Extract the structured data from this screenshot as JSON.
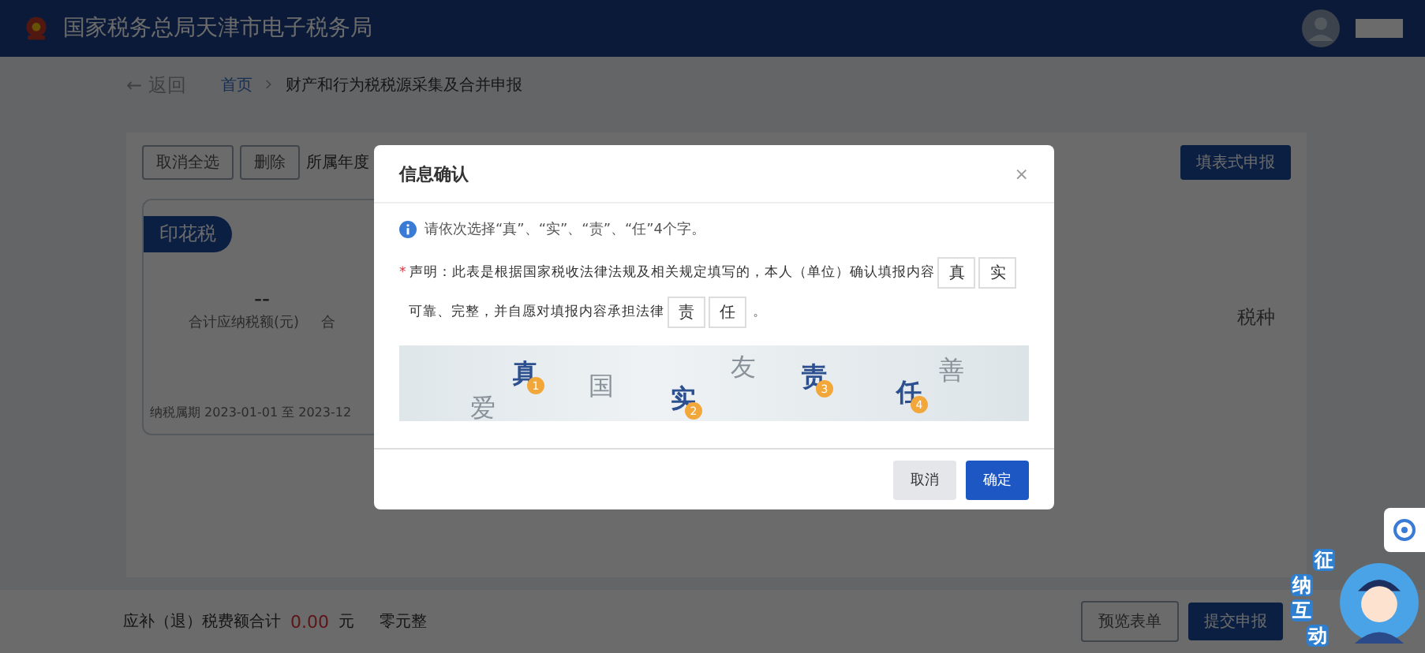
{
  "header": {
    "title": "国家税务总局天津市电子税务局"
  },
  "nav": {
    "back": "← 返回",
    "breadcrumb": [
      "首页",
      "财产和行为税税源采集及合并申报"
    ]
  },
  "toolbar": {
    "buttons": [
      "取消全选",
      "删除"
    ],
    "year_label": "所属年度",
    "form_button": "填表式申报"
  },
  "card": {
    "tag": "印花税",
    "value": "--",
    "labels": [
      "合计应纳税额(元)",
      "合"
    ],
    "period": "纳税属期 2023-01-01 至 2023-12",
    "side_text": "税种"
  },
  "footer": {
    "label": "应补（退）税费额合计",
    "amount": "0.00",
    "unit": "元",
    "words": "零元整",
    "buttons": [
      {
        "label": "预览表单",
        "primary": false
      },
      {
        "label": "提交申报",
        "primary": true
      }
    ]
  },
  "dialog": {
    "title": "信息确认",
    "close": "×",
    "hint": "请依次选择“真”、“实”、“责”、“任”4个字。",
    "statement": {
      "required": "*",
      "text_1": "声明：此表是根据国家税收法律法规及相关规定填写的，本人（单位）确认填报内容",
      "slots_1": [
        "真",
        "实"
      ],
      "text_2": "可靠、完整，并自愿对填报内容承担法律",
      "slots_2": [
        "责",
        "任"
      ],
      "end": "。"
    },
    "captcha": [
      {
        "char": "爱",
        "selected": false
      },
      {
        "char": "真",
        "selected": true,
        "order": "1"
      },
      {
        "char": "国",
        "selected": false
      },
      {
        "char": "实",
        "selected": true,
        "order": "2"
      },
      {
        "char": "友",
        "selected": false
      },
      {
        "char": "责",
        "selected": true,
        "order": "3"
      },
      {
        "char": "任",
        "selected": true,
        "order": "4"
      },
      {
        "char": "善",
        "selected": false
      }
    ],
    "buttons": [
      {
        "label": "取消",
        "primary": false
      },
      {
        "label": "确定",
        "primary": true
      }
    ]
  },
  "assistant": {
    "chars": [
      "征",
      "纳",
      "互",
      "动"
    ]
  }
}
